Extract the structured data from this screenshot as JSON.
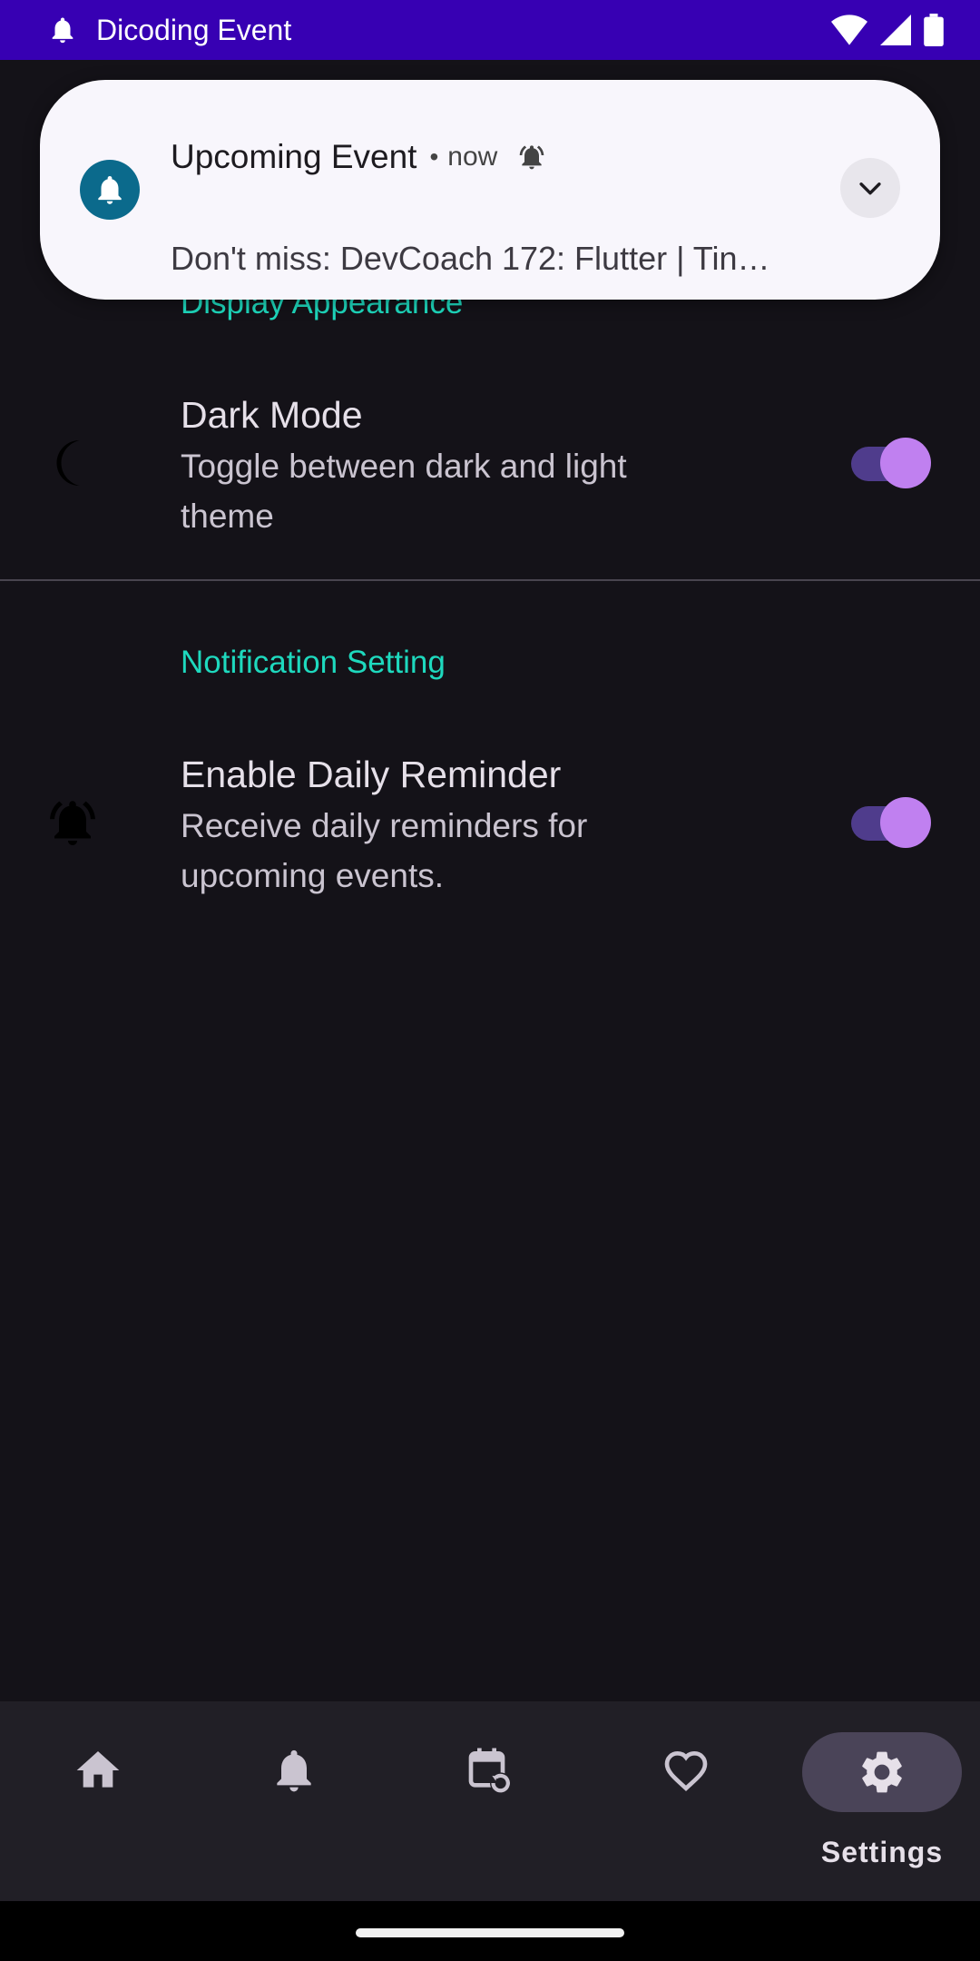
{
  "status_bar": {
    "app_name": "Dicoding Event",
    "icons": [
      "bell-icon",
      "wifi-icon",
      "signal-icon",
      "battery-icon"
    ],
    "background": "#3700B3"
  },
  "notification": {
    "title": "Upcoming Event",
    "separator": "•",
    "time": "now",
    "body": "Don't miss: DevCoach 172: Flutter | Tin…",
    "icons": [
      "bell-icon",
      "alarm-icon",
      "chevron-down-icon"
    ],
    "icon_background": "#0B6A8C"
  },
  "sections": {
    "display": {
      "title": "Display Appearance",
      "item": {
        "title": "Dark Mode",
        "description": "Toggle between dark and light theme",
        "icon": "moon-icon",
        "enabled": true
      }
    },
    "notification": {
      "title": "Notification Setting",
      "item": {
        "title": "Enable Daily Reminder",
        "description": "Receive daily reminders for upcoming events.",
        "icon": "alarm-icon",
        "enabled": true
      }
    }
  },
  "colors": {
    "accent_section": "#1ED9BE",
    "switch_thumb": "#C080F0",
    "switch_track": "#4F3C8C",
    "background": "#141218"
  },
  "bottom_nav": {
    "items": [
      {
        "icon": "home-icon",
        "label": ""
      },
      {
        "icon": "bell-icon",
        "label": ""
      },
      {
        "icon": "calendar-history-icon",
        "label": ""
      },
      {
        "icon": "heart-icon",
        "label": ""
      },
      {
        "icon": "gear-icon",
        "label": "Settings"
      }
    ],
    "active_label": "Settings"
  }
}
